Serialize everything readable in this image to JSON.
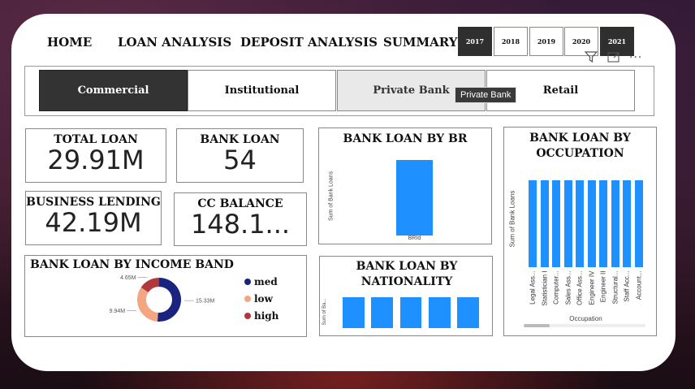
{
  "nav": {
    "home": "HOME",
    "loan_analysis": "LOAN ANALYSIS",
    "deposit_analysis": "DEPOSIT ANALYSIS",
    "summary": "SUMMARY"
  },
  "years": [
    {
      "label": "2017",
      "active": true
    },
    {
      "label": "2018",
      "active": false
    },
    {
      "label": "2019",
      "active": false
    },
    {
      "label": "2020",
      "active": false
    },
    {
      "label": "2021",
      "active": true
    }
  ],
  "toolbar": {
    "filter_icon": "filter-icon",
    "focus_icon": "focus-mode-icon",
    "more_label": "..."
  },
  "tabs": [
    {
      "label": "Commercial",
      "state": "active"
    },
    {
      "label": "Institutional",
      "state": "normal"
    },
    {
      "label": "Private Bank",
      "state": "hover"
    },
    {
      "label": "Retail",
      "state": "normal"
    }
  ],
  "tooltip": "Private Bank",
  "kpis": {
    "total_loan": {
      "label": "TOTAL LOAN",
      "value": "29.91M"
    },
    "bank_loan": {
      "label": "BANK LOAN",
      "value": "54"
    },
    "business_lending": {
      "label": "BUSINESS LENDING",
      "value": "42.19M"
    },
    "cc_balance": {
      "label": "CC BALANCE",
      "value": "148.1..."
    }
  },
  "colors": {
    "bar": "#1e90ff",
    "med": "#1a237e",
    "low": "#f4a582",
    "high": "#b2383a"
  },
  "chart_data": [
    {
      "type": "bar",
      "title": "BANK LOAN BY BR",
      "ylabel": "Sum of Bank Loans",
      "categories": [
        "BRId"
      ],
      "values": [
        1
      ],
      "ylim": [
        0,
        1.1
      ]
    },
    {
      "type": "bar",
      "title": "BANK LOAN BY OCCUPATION",
      "xlabel": "Occupation",
      "ylabel": "Sum of Bank Loans",
      "categories": [
        "Legal Ass...",
        "Statistician I",
        "Computer...",
        "Sales Ass...",
        "Office Ass...",
        "Engineer IV",
        "Engineer II",
        "Structural...",
        "Staff Acc...",
        "Account..."
      ],
      "values": [
        1,
        1,
        1,
        1,
        1,
        1,
        1,
        1,
        1,
        1
      ],
      "ylim": [
        0,
        1.1
      ]
    },
    {
      "type": "pie",
      "title": "BANK LOAN BY INCOME BAND",
      "categories": [
        "med",
        "low",
        "high"
      ],
      "values": [
        15.33,
        9.94,
        4.65
      ],
      "labels": [
        "15.33M",
        "9.94M",
        "4.65M"
      ]
    },
    {
      "type": "bar",
      "title": "BANK LOAN BY NATIONALITY",
      "ylabel": "Sum of Ba...",
      "categories": [
        "",
        "",
        "",
        "",
        ""
      ],
      "values": [
        1,
        1,
        1,
        1,
        1
      ],
      "ylim": [
        0,
        1.1
      ]
    }
  ]
}
